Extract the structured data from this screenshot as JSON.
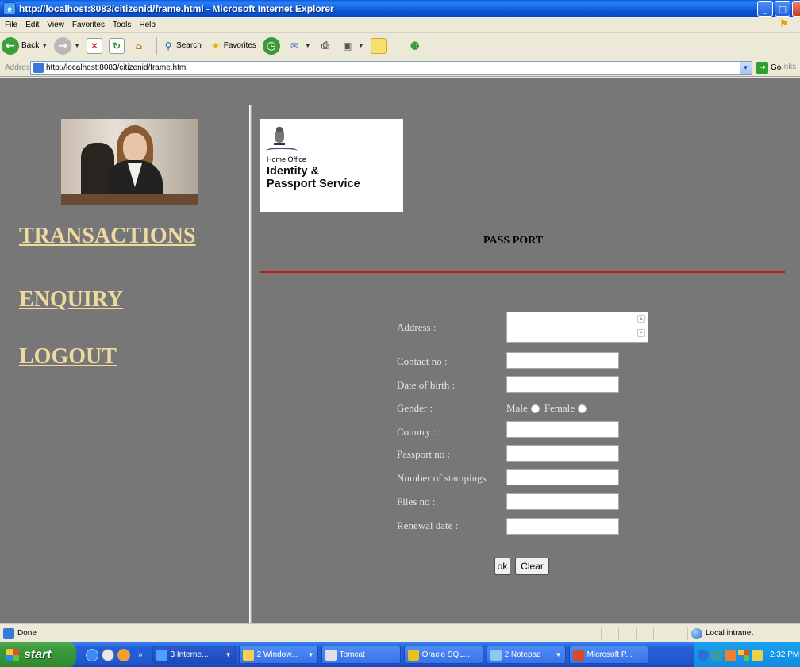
{
  "window": {
    "title": "http://localhost:8083/citizenid/frame.html - Microsoft Internet Explorer"
  },
  "menu": [
    "File",
    "Edit",
    "View",
    "Favorites",
    "Tools",
    "Help"
  ],
  "toolbar": {
    "back_label": "Back",
    "search_label": "Search",
    "favorites_label": "Favorites"
  },
  "addressbar": {
    "label": "Address",
    "url": "http://localhost:8083/citizenid/frame.html",
    "go_label": "Go",
    "links_label": "Links"
  },
  "sidebar": {
    "links": [
      "TRANSACTIONS",
      "ENQUIRY",
      "LOGOUT"
    ]
  },
  "logo": {
    "org": "Home Office",
    "line1": "Identity &",
    "line2": "Passport Service"
  },
  "page": {
    "heading": "PASS PORT"
  },
  "form": {
    "address_label": "Address :",
    "contact_label": "Contact no :",
    "dob_label": "Date of birth :",
    "gender_label": "Gender :",
    "gender_male": "Male",
    "gender_female": "Female",
    "country_label": "Country :",
    "passport_label": "Passport no :",
    "stampings_label": "Number of stampings :",
    "files_label": "Files no :",
    "renewal_label": "Renewal date :",
    "ok_label": "ok",
    "clear_label": "Clear"
  },
  "statusbar": {
    "status": "Done",
    "zone": "Local intranet"
  },
  "taskbar": {
    "start_label": "start",
    "more_label": "»",
    "tasks": [
      "3 Interne...",
      "2 Window...",
      "Tomcat",
      "Oracle SQL...",
      "2 Notepad",
      "Microsoft P..."
    ],
    "clock": "2:32 PM"
  }
}
